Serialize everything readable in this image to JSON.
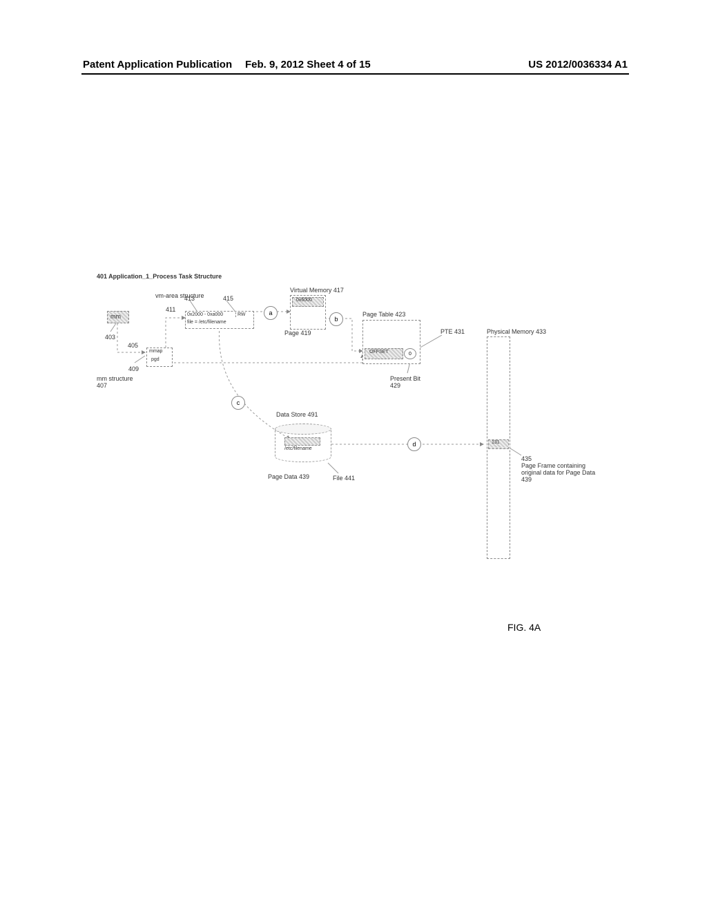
{
  "header": {
    "left": "Patent Application Publication",
    "center": "Feb. 9, 2012  Sheet 4 of 15",
    "right": "US 2012/0036334 A1"
  },
  "figure_caption": "FIG. 4A",
  "diagram": {
    "title": "401 Application_1_Process Task Structure",
    "mm_box": "mm",
    "ref_403": "403",
    "vm_area_label": "vm-area structure",
    "ref_411": "411",
    "ref_413": "413",
    "ref_415": "415",
    "vma_range": "0x2000 - 0xa000",
    "vma_perm": "RW",
    "vma_file": "file = /etc/filename",
    "mmap_label": "mmap",
    "ref_409": "409",
    "ref_pgd": "pgd",
    "ref_405": "405",
    "mm_structure": "mm structure",
    "ref_407": "407",
    "virtual_memory": "Virtual Memory 417",
    "vm_addr": "0x6000",
    "page_419": "Page 419",
    "step_a": "a",
    "step_b": "b",
    "step_c": "c",
    "step_d": "d",
    "page_table": "Page Table 423",
    "pte_offset": "OFFSET",
    "pte_flag": "0",
    "present_bit": "Present Bit",
    "ref_429": "429",
    "pte_431": "PTE 431",
    "physical_memory": "Physical Memory 433",
    "pm_addr": "131",
    "ref_435": "435",
    "page_frame_desc": "Page Frame containing original data for Page Data 439",
    "data_store": "Data Store 491",
    "file_path": "/etc/filename",
    "page_data_439": "Page Data 439",
    "file_441": "File 441"
  }
}
